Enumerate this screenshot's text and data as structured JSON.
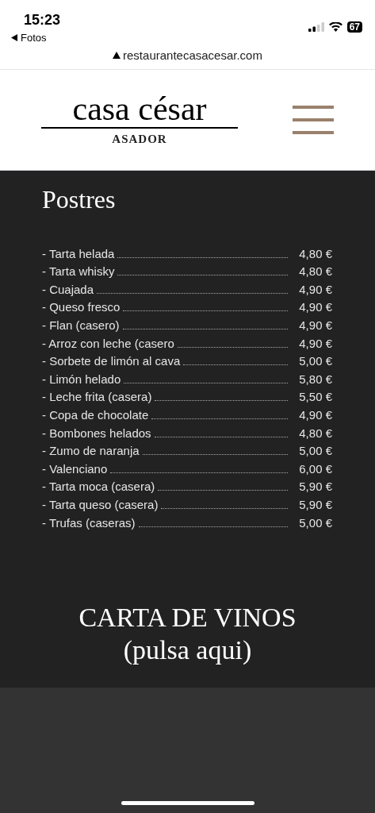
{
  "status_bar": {
    "time": "15:23",
    "back_app": "Fotos",
    "battery": "67"
  },
  "browser": {
    "url": "restaurantecasacesar.com"
  },
  "header": {
    "logo_name": "casa césar",
    "logo_subtitle": "ASADOR"
  },
  "section": {
    "title": "Postres",
    "items": [
      {
        "name": "- Tarta helada",
        "price": "4,80 €"
      },
      {
        "name": "- Tarta whisky",
        "price": "4,80 €"
      },
      {
        "name": "- Cuajada",
        "price": "4,90 €"
      },
      {
        "name": "- Queso fresco",
        "price": "4,90 €"
      },
      {
        "name": "- Flan (casero)",
        "price": "4,90 €"
      },
      {
        "name": "- Arroz con leche (casero",
        "price": "4,90 €"
      },
      {
        "name": "- Sorbete de limón al cava",
        "price": "5,00 €"
      },
      {
        "name": "- Limón helado",
        "price": "5,80 €"
      },
      {
        "name": "- Leche frita (casera)",
        "price": "5,50 €"
      },
      {
        "name": "- Copa de chocolate",
        "price": "4,90 €"
      },
      {
        "name": "- Bombones helados",
        "price": "4,80 €"
      },
      {
        "name": "- Zumo de naranja",
        "price": "5,00 €"
      },
      {
        "name": "- Valenciano",
        "price": "6,00 €"
      },
      {
        "name": "- Tarta moca (casera)",
        "price": "5,90 €"
      },
      {
        "name": "- Tarta queso (casera)",
        "price": "5,90 €"
      },
      {
        "name": "- Trufas (caseras)",
        "price": "5,00 €"
      }
    ]
  },
  "wine_link": {
    "line_1": "CARTA DE VINOS",
    "line_2": "(pulsa aqui)"
  }
}
